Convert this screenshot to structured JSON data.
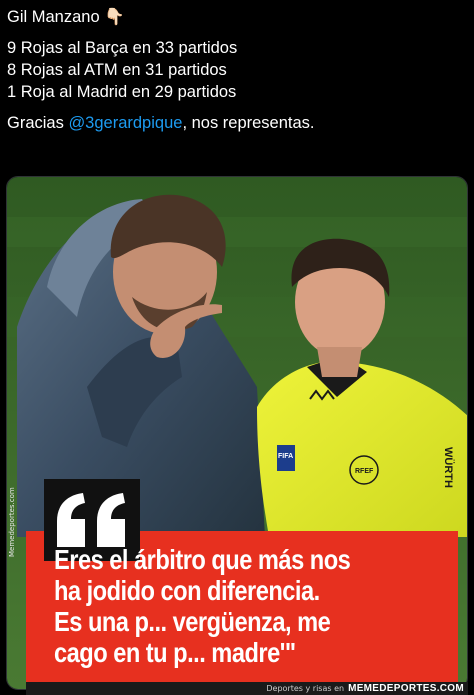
{
  "tweet": {
    "author_line": "Gil Manzano",
    "emoji": "👇🏻",
    "stats": [
      "9 Rojas al Barça en 33 partidos",
      "8 Rojas al ATM en 31 partidos",
      "1 Roja al Madrid en 29 partidos"
    ],
    "thanks_prefix": "Gracias ",
    "mention": "@3gerardpique",
    "thanks_suffix": ", nos representas."
  },
  "image": {
    "side_watermark": "Memedeportes.com",
    "quote_lines": [
      "Eres el árbitro que más nos",
      "ha jodido con diferencia.",
      "Es una p... vergüenza, me",
      "cago en tu p... madre'\""
    ],
    "footer_small": "Deportes y risas en",
    "footer_brand": "MEMEDEPORTES.COM",
    "shirt_badge": "FIFA",
    "shirt_brand": "WÜRTH",
    "crest": "RFEF",
    "colors": {
      "pitch": "#3f6e2b",
      "referee_kit": "#e2ee2e",
      "quote_bg": "#e7301f",
      "mention": "#1d9bf0"
    }
  }
}
